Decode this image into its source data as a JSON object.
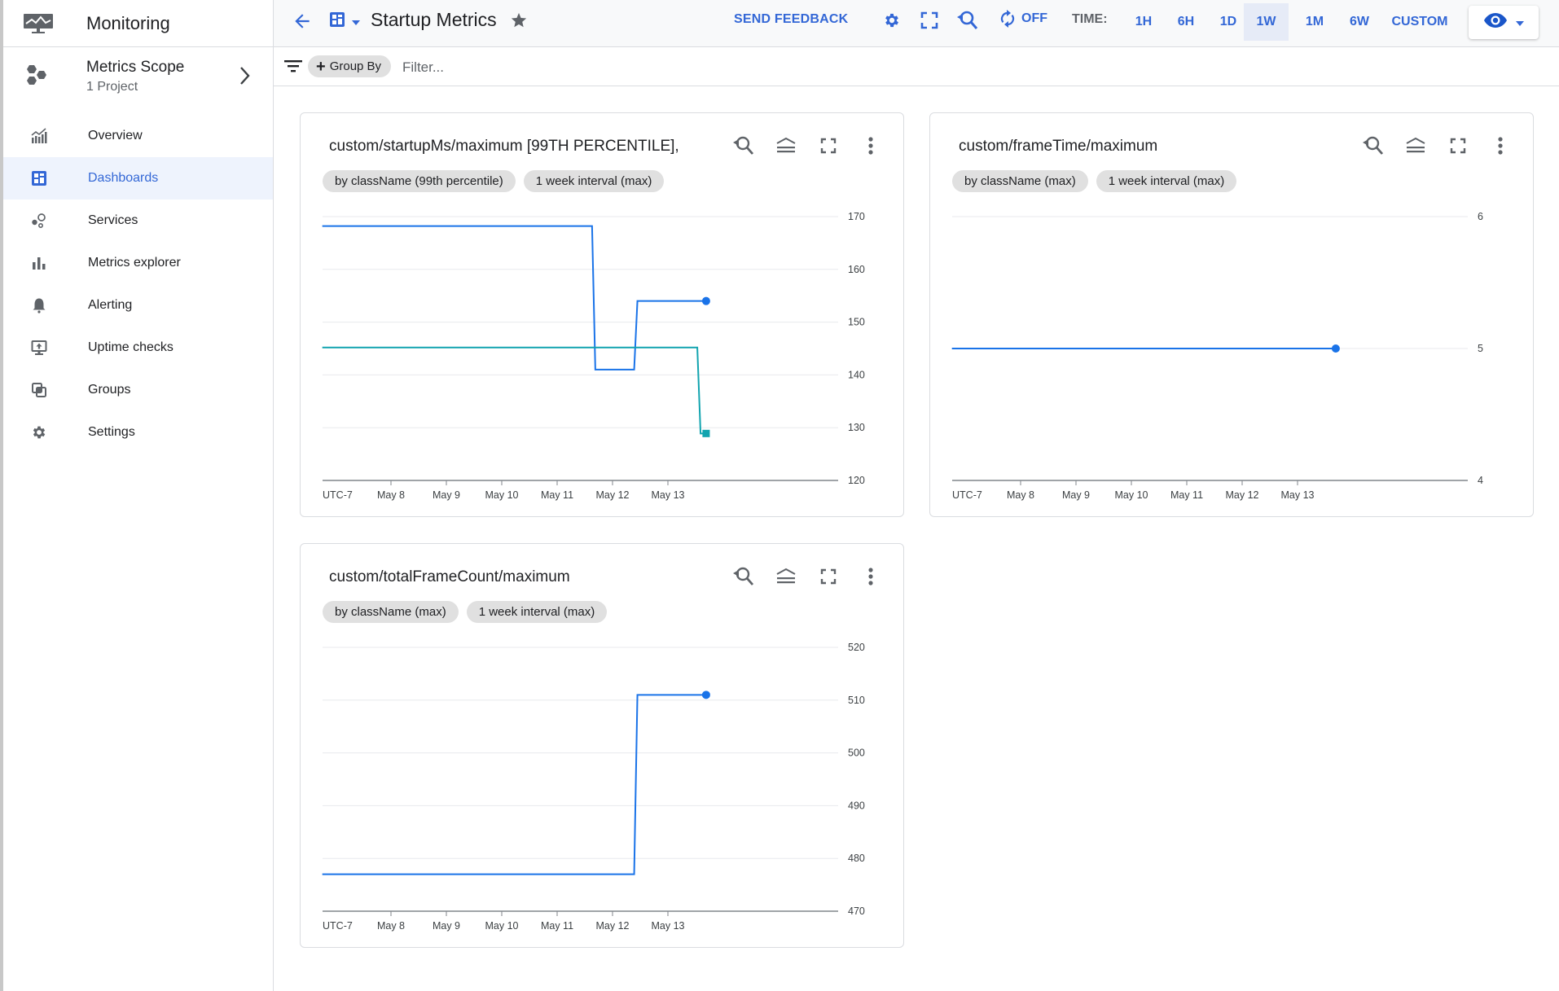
{
  "sidebar": {
    "app_title": "Monitoring",
    "scope": {
      "title": "Metrics Scope",
      "subtitle": "1 Project"
    },
    "items": [
      {
        "label": "Overview",
        "icon": "overview-chart-icon",
        "active": false
      },
      {
        "label": "Dashboards",
        "icon": "dashboard-icon",
        "active": true
      },
      {
        "label": "Services",
        "icon": "services-icon",
        "active": false
      },
      {
        "label": "Metrics explorer",
        "icon": "bar-chart-icon",
        "active": false
      },
      {
        "label": "Alerting",
        "icon": "bell-icon",
        "active": false
      },
      {
        "label": "Uptime checks",
        "icon": "monitor-upload-icon",
        "active": false
      },
      {
        "label": "Groups",
        "icon": "groups-icon",
        "active": false
      },
      {
        "label": "Settings",
        "icon": "gear-icon",
        "active": false
      }
    ]
  },
  "topbar": {
    "title": "Startup Metrics",
    "send_feedback": "SEND FEEDBACK",
    "auto_refresh": "OFF",
    "time_label": "TIME:",
    "time_options": [
      "1H",
      "6H",
      "1D",
      "1W",
      "1M",
      "6W",
      "CUSTOM"
    ],
    "time_selected": "1W"
  },
  "filterbar": {
    "group_by": "Group By",
    "filter_placeholder": "Filter..."
  },
  "colors": {
    "accent": "#3367d6",
    "series_blue": "#1a73e8",
    "series_teal": "#12a4af",
    "active_bg": "#eef3fd"
  },
  "chart_data": [
    {
      "type": "line",
      "title": "custom/startupMs/maximum [99TH PERCENTILE],",
      "chips": [
        "by className (99th percentile)",
        "1 week interval (max)"
      ],
      "timezone_label": "UTC-7",
      "x_ticks": [
        "May 8",
        "May 9",
        "May 10",
        "May 11",
        "May 12",
        "May 13"
      ],
      "x_tick_days": [
        8,
        9,
        10,
        11,
        12,
        13
      ],
      "xlim": [
        6.76,
        13.69
      ],
      "ylim": [
        120,
        170
      ],
      "y_ticks": [
        120,
        130,
        140,
        150,
        160,
        170
      ],
      "grid": true,
      "step": true,
      "series": [
        {
          "name": "series-1",
          "color": "#1a73e8",
          "marker": "circle",
          "x": [
            6.76,
            11.66,
            12.42,
            13.69
          ],
          "y": [
            168.2,
            141,
            154,
            154
          ]
        },
        {
          "name": "series-2",
          "color": "#12a4af",
          "marker": "square",
          "x": [
            6.76,
            13.56,
            13.69
          ],
          "y": [
            145.2,
            128.9,
            128.9
          ]
        }
      ]
    },
    {
      "type": "line",
      "title": "custom/frameTime/maximum",
      "chips": [
        "by className (max)",
        "1 week interval (max)"
      ],
      "timezone_label": "UTC-7",
      "x_ticks": [
        "May 8",
        "May 9",
        "May 10",
        "May 11",
        "May 12",
        "May 13"
      ],
      "x_tick_days": [
        8,
        9,
        10,
        11,
        12,
        13
      ],
      "xlim": [
        6.76,
        13.69
      ],
      "ylim": [
        4,
        6
      ],
      "y_ticks": [
        4,
        5,
        6
      ],
      "grid": true,
      "step": true,
      "series": [
        {
          "name": "series-1",
          "color": "#1a73e8",
          "marker": "circle",
          "x": [
            6.76,
            13.69
          ],
          "y": [
            5,
            5
          ]
        }
      ]
    },
    {
      "type": "line",
      "title": "custom/totalFrameCount/maximum",
      "chips": [
        "by className (max)",
        "1 week interval (max)"
      ],
      "timezone_label": "UTC-7",
      "x_ticks": [
        "May 8",
        "May 9",
        "May 10",
        "May 11",
        "May 12",
        "May 13"
      ],
      "x_tick_days": [
        8,
        9,
        10,
        11,
        12,
        13
      ],
      "xlim": [
        6.76,
        13.69
      ],
      "ylim": [
        470,
        520
      ],
      "y_ticks": [
        470,
        480,
        490,
        500,
        510,
        520
      ],
      "grid": true,
      "step": true,
      "series": [
        {
          "name": "series-1",
          "color": "#1a73e8",
          "marker": "circle",
          "x": [
            6.76,
            12.42,
            13.69
          ],
          "y": [
            477,
            511,
            511
          ]
        }
      ]
    }
  ]
}
